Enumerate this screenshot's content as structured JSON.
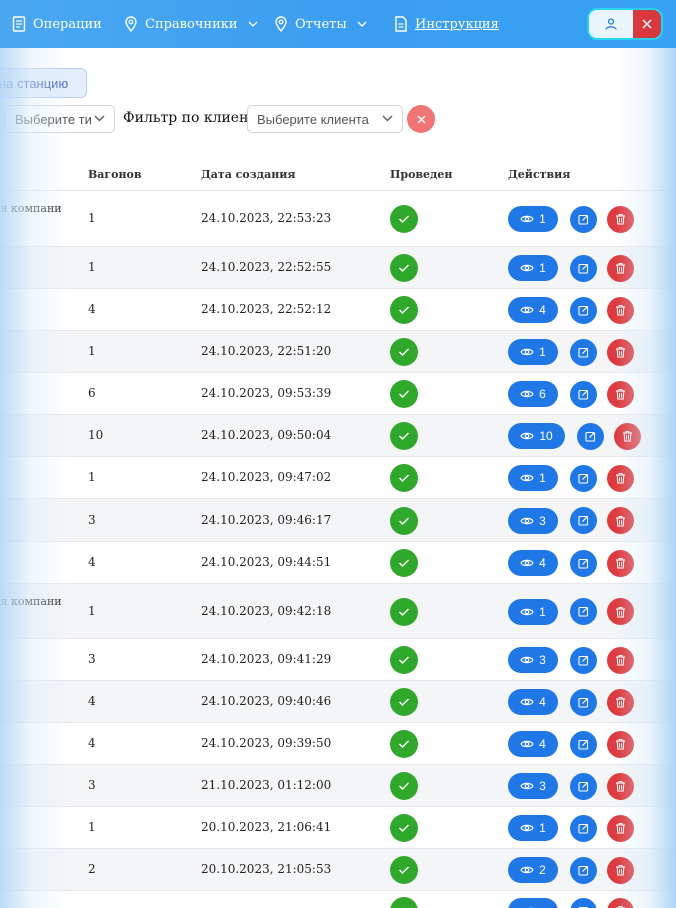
{
  "nav": {
    "operations": "Операции",
    "references": "Справочники",
    "reports": "Отчеты",
    "instructions": "Инструкция"
  },
  "toolbar": {
    "station_button": "на станцию",
    "type_select_placeholder": "Выберите ти",
    "client_filter_label": "Фильтр по клиенту",
    "client_select_placeholder": "Выберите клиента"
  },
  "table": {
    "headers": {
      "wagons": "Вагонов",
      "created": "Дата создания",
      "posted": "Проведен",
      "actions": "Действия"
    },
    "rows": [
      {
        "client": "ая компани",
        "wagons": "1",
        "date": "24.10.2023, 22:53:23",
        "view": "1"
      },
      {
        "client": "",
        "wagons": "1",
        "date": "24.10.2023, 22:52:55",
        "view": "1"
      },
      {
        "client": "",
        "wagons": "4",
        "date": "24.10.2023, 22:52:12",
        "view": "4"
      },
      {
        "client": "",
        "wagons": "1",
        "date": "24.10.2023, 22:51:20",
        "view": "1"
      },
      {
        "client": "»",
        "wagons": "6",
        "date": "24.10.2023, 09:53:39",
        "view": "6"
      },
      {
        "client": "",
        "wagons": "10",
        "date": "24.10.2023, 09:50:04",
        "view": "10"
      },
      {
        "client": "",
        "wagons": "1",
        "date": "24.10.2023, 09:47:02",
        "view": "1"
      },
      {
        "client": "»",
        "wagons": "3",
        "date": "24.10.2023, 09:46:17",
        "view": "3"
      },
      {
        "client": "",
        "wagons": "4",
        "date": "24.10.2023, 09:44:51",
        "view": "4"
      },
      {
        "client": "ая компани",
        "wagons": "1",
        "date": "24.10.2023, 09:42:18",
        "view": "1"
      },
      {
        "client": "»",
        "wagons": "3",
        "date": "24.10.2023, 09:41:29",
        "view": "3"
      },
      {
        "client": "",
        "wagons": "4",
        "date": "24.10.2023, 09:40:46",
        "view": "4"
      },
      {
        "client": "",
        "wagons": "4",
        "date": "24.10.2023, 09:39:50",
        "view": "4"
      },
      {
        "client": "",
        "wagons": "3",
        "date": "21.10.2023, 01:12:00",
        "view": "3"
      },
      {
        "client": "",
        "wagons": "1",
        "date": "20.10.2023, 21:06:41",
        "view": "1"
      },
      {
        "client": "",
        "wagons": "2",
        "date": "20.10.2023, 21:05:53",
        "view": "2"
      },
      {
        "client": "",
        "wagons": "",
        "date": "",
        "view": ""
      }
    ]
  },
  "icons": {
    "operations": "document-icon",
    "references": "location-pin-icon",
    "reports": "location-pin-icon",
    "instructions": "file-icon",
    "user": "user-icon",
    "logout": "close-icon",
    "posted": "check-icon",
    "view": "eye-icon",
    "edit": "edit-icon",
    "delete": "trash-icon"
  },
  "colors": {
    "navbar": "#3b9ef0",
    "primary": "#1f78e6",
    "success": "#2fa82c",
    "danger": "#dd3b3f"
  }
}
